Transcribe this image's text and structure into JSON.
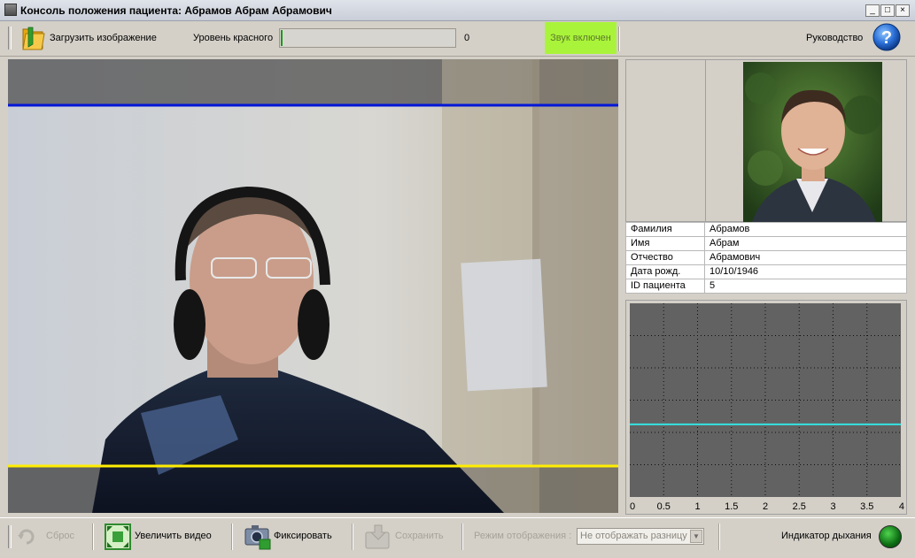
{
  "window": {
    "title": "Консоль положения пациента: Абрамов Абрам Абрамович",
    "buttons": {
      "minimize": "_",
      "maximize": "□",
      "close": "×"
    }
  },
  "toolbar": {
    "load_label": "Загрузить изображение",
    "red_level_label": "Уровень красного",
    "red_level_value": "0",
    "red_level_fraction": 0.0,
    "sound_label": "Звук включен",
    "sound_color": "#a9f43a",
    "guide_label": "Руководство",
    "help_icon_glyph": "?"
  },
  "video": {
    "top_line_color": "#0016d8",
    "bottom_line_color": "#ffee00"
  },
  "patient": {
    "fields": [
      {
        "label": "Фамилия",
        "value": "Абрамов"
      },
      {
        "label": "Имя",
        "value": "Абрам"
      },
      {
        "label": "Отчество",
        "value": "Абрамович"
      },
      {
        "label": "Дата  рожд.",
        "value": "10/10/1946"
      },
      {
        "label": "ID пациента",
        "value": "5"
      }
    ]
  },
  "chart_data": {
    "type": "line",
    "title": "",
    "xlabel": "",
    "ylabel": "",
    "xlim": [
      0,
      4
    ],
    "x_ticks": [
      "0",
      "0.5",
      "1",
      "1.5",
      "2",
      "2.5",
      "3",
      "3.5",
      "4"
    ],
    "ylim": [
      0,
      1
    ],
    "grid": true,
    "background": "#626262",
    "series": [
      {
        "color": "#35e3e3",
        "x": [
          0,
          4
        ],
        "y": [
          0.375,
          0.375
        ]
      }
    ]
  },
  "bottom": {
    "reset_label": "Сброс",
    "zoom_label": "Увеличить видео",
    "fix_label": "Фиксировать",
    "save_label": "Сохранить",
    "mode_label": "Режим отображения :",
    "mode_value": "Не отображать разницу",
    "breath_label": "Индикатор дыхания",
    "breath_color": "#1aa01a"
  }
}
